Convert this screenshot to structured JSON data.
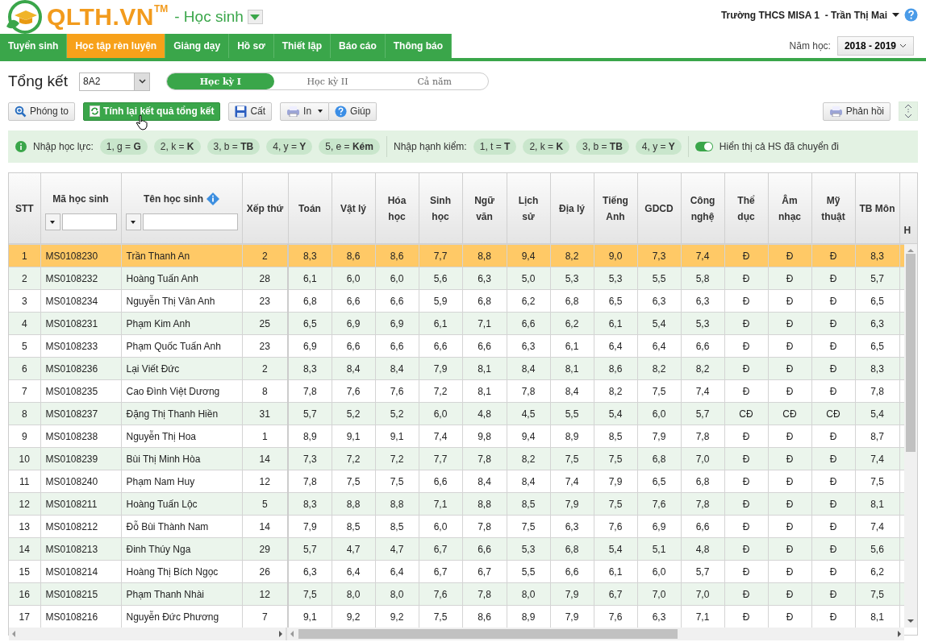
{
  "app": {
    "brand": "QLTH.VN",
    "trademark": "TM",
    "module": "- Học sinh"
  },
  "account": {
    "label": "Trường THCS MISA 1  - Trần Thị Mai"
  },
  "nav_tabs": [
    {
      "label": "Tuyển sinh",
      "selected": false
    },
    {
      "label": "Học tập rèn luyện",
      "selected": true
    },
    {
      "label": "Giảng dạy",
      "selected": false
    },
    {
      "label": "Hồ sơ",
      "selected": false
    },
    {
      "label": "Thiết lập",
      "selected": false
    },
    {
      "label": "Báo cáo",
      "selected": false
    },
    {
      "label": "Thông báo",
      "selected": false
    }
  ],
  "school_year": {
    "label": "Năm học:",
    "value": "2018 - 2019"
  },
  "page": {
    "title": "Tổng kết",
    "class_value": "8A2"
  },
  "term_tabs": [
    {
      "label": "Học kỳ I",
      "selected": true
    },
    {
      "label": "Học kỳ II",
      "selected": false
    },
    {
      "label": "Cả năm",
      "selected": false
    }
  ],
  "toolbar": [
    {
      "label": "Phóng to",
      "kind": "zoom"
    },
    {
      "label": "Tính lại kết quả tổng kết",
      "kind": "recalc"
    },
    {
      "label": "Cất",
      "kind": "save"
    },
    {
      "label": "In",
      "kind": "print"
    },
    {
      "label": "Giúp",
      "kind": "help"
    }
  ],
  "feedback_button": {
    "label": "Phản hồi"
  },
  "legend": {
    "academic_label": "Nhập học lực:",
    "academic_codes": [
      "1, g = **G**",
      "2, k = **K**",
      "3, b = **TB**",
      "4, y = **Y**",
      "5, e = **Kém**"
    ],
    "conduct_label": "Nhập hạnh kiểm:",
    "conduct_codes": [
      "1, t = **T**",
      "2, k = **K**",
      "3, b = **TB**",
      "4, y = **Y**"
    ],
    "toggle": {
      "label": "Hiển thị cả HS đã chuyển đi",
      "on": true
    }
  },
  "table": {
    "columns": [
      "STT",
      "Mã học sinh",
      "Tên học sinh",
      "Xếp thứ",
      "Toán",
      "Vật lý",
      "Hóa học",
      "Sinh học",
      "Ngữ văn",
      "Lịch sử",
      "Địa lý",
      "Tiếng Anh",
      "GDCD",
      "Công nghệ",
      "Thể dục",
      "Âm nhạc",
      "Mỹ thuật",
      "TB Môn",
      "H"
    ],
    "rows": [
      {
        "selected": true,
        "cells": [
          "1",
          "MS0108230",
          "Trần Thanh An",
          "2",
          "8,3",
          "8,6",
          "8,6",
          "7,7",
          "8,8",
          "9,4",
          "8,2",
          "9,0",
          "7,3",
          "7,4",
          "Đ",
          "Đ",
          "Đ",
          "8,3"
        ]
      },
      {
        "selected": false,
        "cells": [
          "2",
          "MS0108232",
          "Hoàng Tuấn Anh",
          "28",
          "6,1",
          "6,0",
          "6,0",
          "5,6",
          "6,3",
          "5,0",
          "5,3",
          "5,3",
          "5,5",
          "5,8",
          "Đ",
          "Đ",
          "Đ",
          "5,7"
        ]
      },
      {
        "selected": false,
        "cells": [
          "3",
          "MS0108234",
          "Nguyễn Thị Vân Anh",
          "23",
          "6,8",
          "6,6",
          "6,6",
          "5,9",
          "6,8",
          "6,2",
          "6,8",
          "6,5",
          "6,3",
          "6,3",
          "Đ",
          "Đ",
          "Đ",
          "6,5"
        ]
      },
      {
        "selected": false,
        "cells": [
          "4",
          "MS0108231",
          "Phạm Kim Anh",
          "25",
          "6,5",
          "6,9",
          "6,9",
          "6,1",
          "7,1",
          "6,6",
          "6,2",
          "6,1",
          "5,4",
          "5,3",
          "Đ",
          "Đ",
          "Đ",
          "6,3"
        ]
      },
      {
        "selected": false,
        "cells": [
          "5",
          "MS0108233",
          "Phạm Quốc Tuấn Anh",
          "23",
          "6,9",
          "6,6",
          "6,6",
          "6,6",
          "6,6",
          "6,3",
          "6,1",
          "6,4",
          "6,4",
          "6,6",
          "Đ",
          "Đ",
          "Đ",
          "6,5"
        ]
      },
      {
        "selected": false,
        "cells": [
          "6",
          "MS0108236",
          "Lại Viết Đức",
          "2",
          "8,3",
          "8,4",
          "8,4",
          "7,9",
          "8,1",
          "8,4",
          "8,1",
          "8,6",
          "8,2",
          "8,2",
          "Đ",
          "Đ",
          "Đ",
          "8,3"
        ]
      },
      {
        "selected": false,
        "cells": [
          "7",
          "MS0108235",
          "Cao Đình Việt Dương",
          "8",
          "7,8",
          "7,6",
          "7,6",
          "7,2",
          "8,1",
          "7,8",
          "8,4",
          "8,2",
          "7,5",
          "7,4",
          "Đ",
          "Đ",
          "Đ",
          "7,8"
        ]
      },
      {
        "selected": false,
        "cells": [
          "8",
          "MS0108237",
          "Đặng Thị Thanh Hiền",
          "31",
          "5,7",
          "5,2",
          "5,2",
          "6,0",
          "4,8",
          "4,5",
          "5,5",
          "5,4",
          "6,0",
          "5,7",
          "CĐ",
          "CĐ",
          "CĐ",
          "5,4"
        ]
      },
      {
        "selected": false,
        "cells": [
          "9",
          "MS0108238",
          "Nguyễn Thị Hoa",
          "1",
          "8,9",
          "9,1",
          "9,1",
          "7,4",
          "9,8",
          "9,4",
          "8,9",
          "8,5",
          "7,9",
          "7,8",
          "Đ",
          "Đ",
          "Đ",
          "8,7"
        ]
      },
      {
        "selected": false,
        "cells": [
          "10",
          "MS0108239",
          "Bùi Thị Minh Hòa",
          "14",
          "7,3",
          "7,2",
          "7,2",
          "7,7",
          "7,8",
          "8,2",
          "7,5",
          "7,5",
          "6,8",
          "7,0",
          "Đ",
          "Đ",
          "Đ",
          "7,4"
        ]
      },
      {
        "selected": false,
        "cells": [
          "11",
          "MS0108240",
          "Phạm Nam Huy",
          "12",
          "7,8",
          "7,5",
          "7,5",
          "6,6",
          "8,4",
          "8,4",
          "7,4",
          "7,9",
          "6,5",
          "6,8",
          "Đ",
          "Đ",
          "Đ",
          "7,5"
        ]
      },
      {
        "selected": false,
        "cells": [
          "12",
          "MS0108211",
          "Hoàng Tuấn Lộc",
          "5",
          "8,3",
          "8,8",
          "8,8",
          "7,1",
          "8,8",
          "8,5",
          "7,9",
          "7,5",
          "7,6",
          "7,8",
          "Đ",
          "Đ",
          "Đ",
          "8,1"
        ]
      },
      {
        "selected": false,
        "cells": [
          "13",
          "MS0108212",
          "Đỗ Bùi Thành Nam",
          "14",
          "7,9",
          "8,5",
          "8,5",
          "6,0",
          "7,8",
          "7,5",
          "6,3",
          "7,6",
          "6,9",
          "6,6",
          "Đ",
          "Đ",
          "Đ",
          "7,4"
        ]
      },
      {
        "selected": false,
        "cells": [
          "14",
          "MS0108213",
          "Đinh Thúy Nga",
          "29",
          "5,7",
          "4,7",
          "4,7",
          "6,7",
          "6,6",
          "5,3",
          "6,8",
          "5,4",
          "5,1",
          "4,8",
          "Đ",
          "Đ",
          "Đ",
          "5,6"
        ]
      },
      {
        "selected": false,
        "cells": [
          "15",
          "MS0108214",
          "Hoàng Thị Bích Ngọc",
          "26",
          "6,3",
          "6,4",
          "6,4",
          "6,7",
          "6,7",
          "5,5",
          "6,6",
          "6,1",
          "6,0",
          "5,7",
          "Đ",
          "Đ",
          "Đ",
          "6,2"
        ]
      },
      {
        "selected": false,
        "cells": [
          "16",
          "MS0108215",
          "Phạm Thanh Nhài",
          "12",
          "7,5",
          "8,0",
          "8,0",
          "7,6",
          "7,8",
          "8,0",
          "7,9",
          "6,7",
          "7,0",
          "7,0",
          "Đ",
          "Đ",
          "Đ",
          "7,5"
        ]
      },
      {
        "selected": false,
        "cells": [
          "17",
          "MS0108216",
          "Nguyễn Đức Phương",
          "7",
          "9,1",
          "9,2",
          "9,2",
          "7,5",
          "8,6",
          "8,9",
          "7,9",
          "7,6",
          "6,3",
          "7,1",
          "Đ",
          "Đ",
          "Đ",
          "8,1"
        ]
      }
    ]
  }
}
